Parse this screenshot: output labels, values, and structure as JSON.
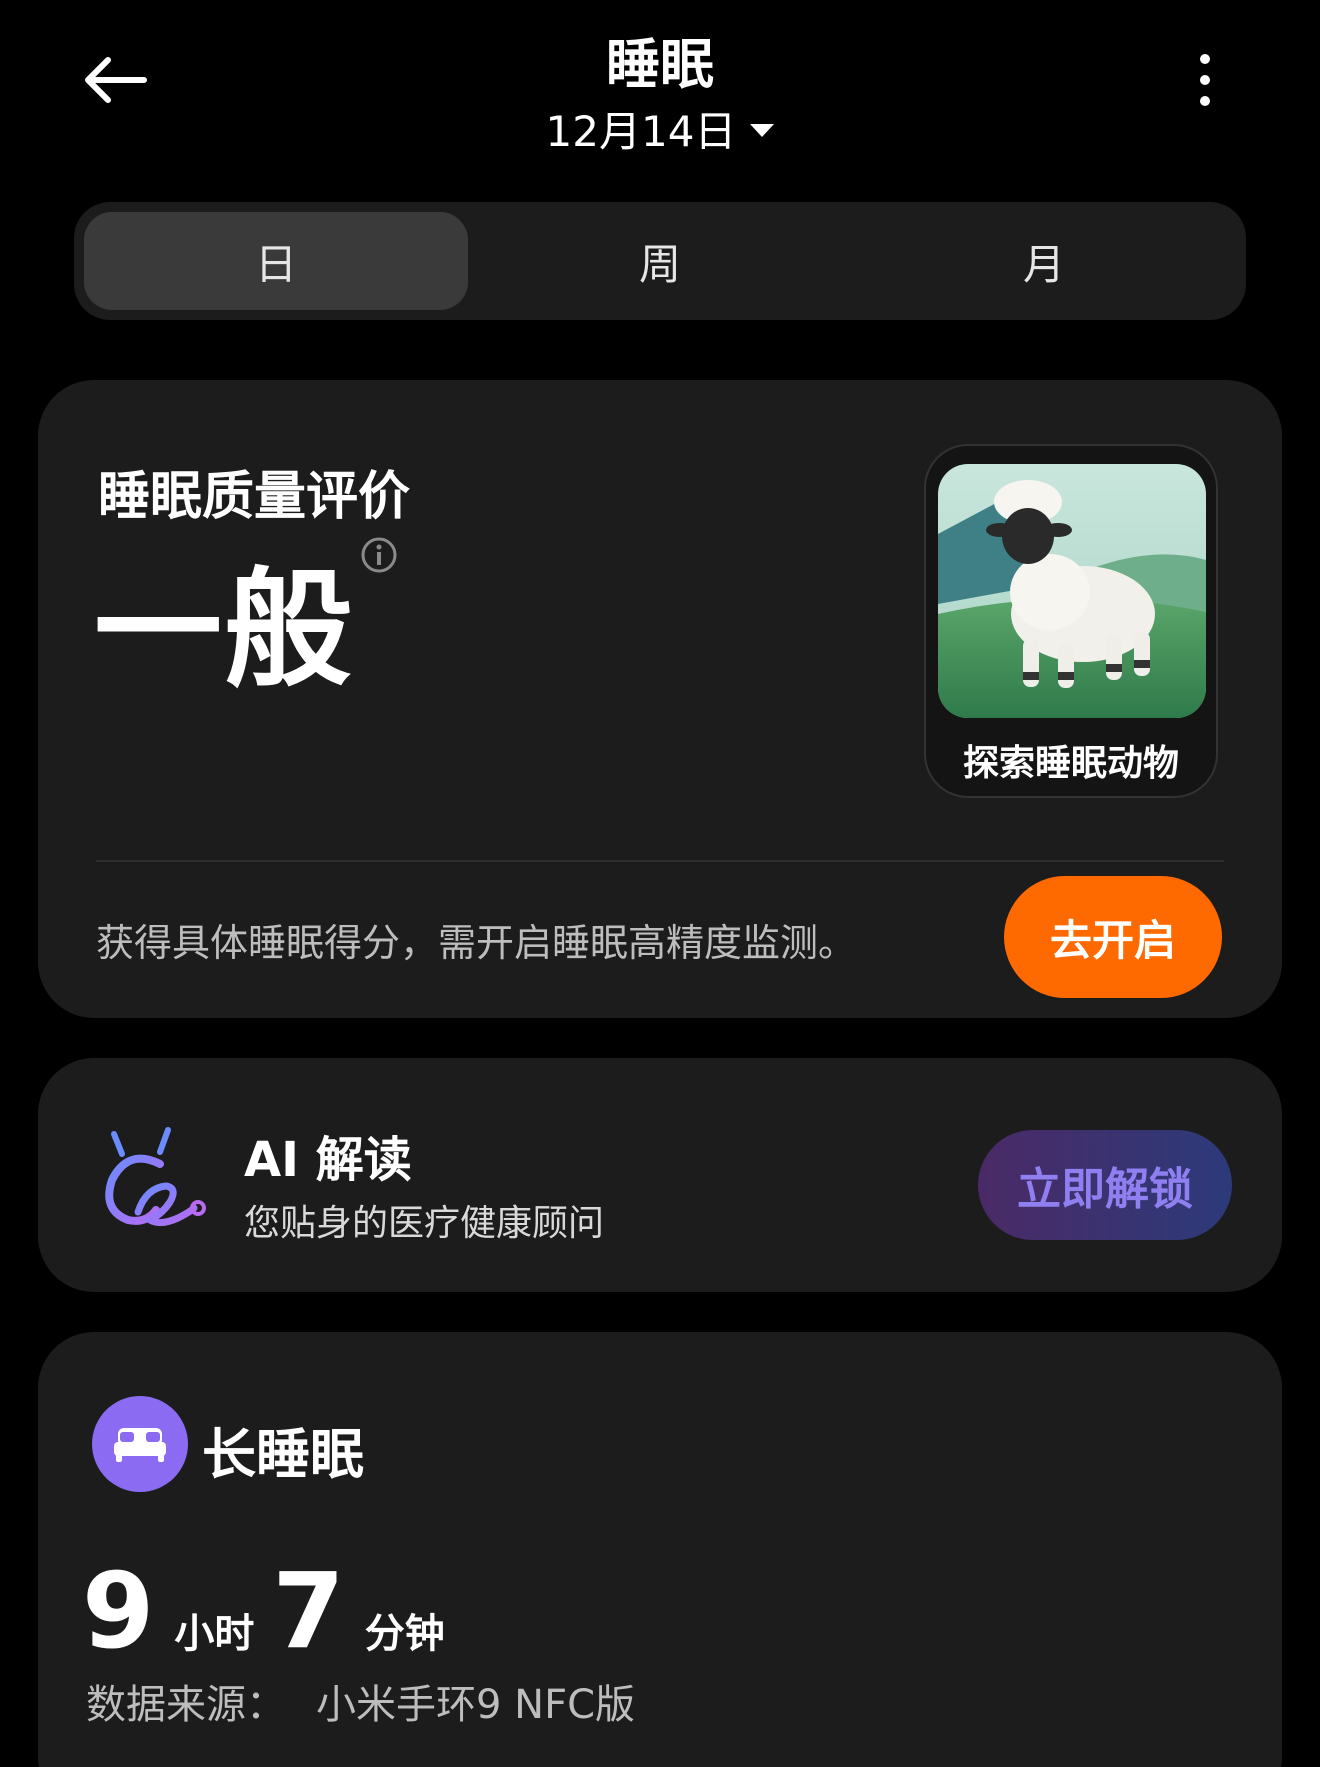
{
  "header": {
    "title": "睡眠",
    "date": "12月14日"
  },
  "tabs": [
    {
      "label": "日",
      "active": true
    },
    {
      "label": "周",
      "active": false
    },
    {
      "label": "月",
      "active": false
    }
  ],
  "quality_card": {
    "label": "睡眠质量评价",
    "value": "一般",
    "animal_caption": "探索睡眠动物",
    "hint": "获得具体睡眠得分，需开启睡眠高精度监测。",
    "open_button": "去开启"
  },
  "ai_card": {
    "title": "AI 解读",
    "subtitle": "您贴身的医疗健康顾问",
    "unlock_button": "立即解锁"
  },
  "sleep_card": {
    "title": "长睡眠",
    "hours": "9",
    "hours_unit": "小时",
    "minutes": "7",
    "minutes_unit": "分钟",
    "source_label": "数据来源：",
    "source_value": "小米手环9 NFC版"
  },
  "colors": {
    "accent_orange": "#ff6a00",
    "bed_purple": "#8b6bf2",
    "unlock_text": "#8f7ff0"
  }
}
